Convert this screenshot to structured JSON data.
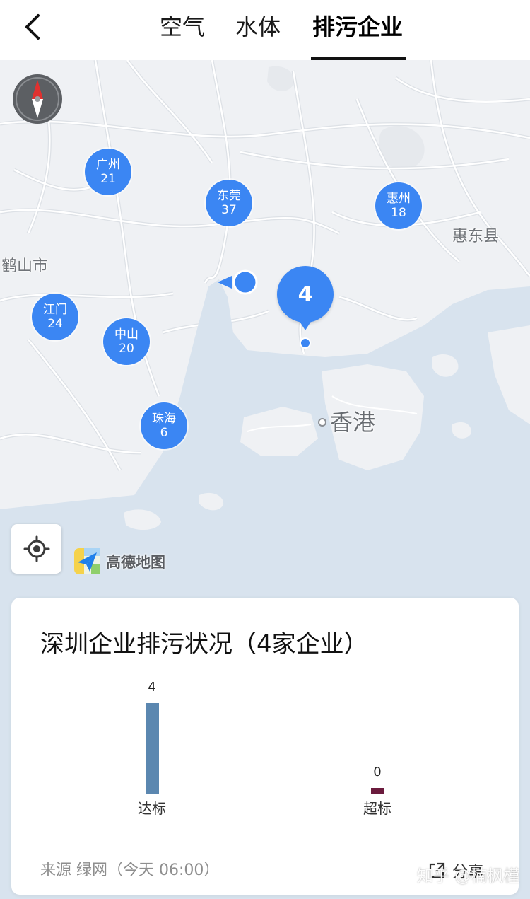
{
  "top_bar": {
    "back_icon": "chevron-left-icon",
    "tabs": [
      {
        "label": "空气",
        "selected": false
      },
      {
        "label": "水体",
        "selected": false
      },
      {
        "label": "排污企业",
        "selected": true
      }
    ]
  },
  "map": {
    "compass_icon": "compass-icon",
    "clusters": [
      {
        "city": "广州",
        "count": 21
      },
      {
        "city": "东莞",
        "count": 37
      },
      {
        "city": "惠州",
        "count": 18
      },
      {
        "city": "江门",
        "count": 24
      },
      {
        "city": "中山",
        "count": 20
      },
      {
        "city": "珠海",
        "count": 6
      }
    ],
    "selected_cluster": {
      "count": 4
    },
    "place_labels": {
      "huidong": "惠东县",
      "heshan": "鹤山市",
      "hongkong": "香港"
    },
    "location_marker_icon": "location-arrow-icon",
    "locate_icon": "crosshair-icon",
    "provider_logo_icon": "amap-logo-icon",
    "provider": "高德地图",
    "colors": {
      "cluster": "#3b86f3",
      "land": "#eff1f4",
      "sea": "#d8e3ee"
    }
  },
  "card": {
    "title": "深圳企业排污状况（4家企业）",
    "source": "来源 绿网（今天 06:00）",
    "share_icon": "share-icon",
    "share_label": "分享"
  },
  "chart_data": {
    "type": "bar",
    "categories": [
      "达标",
      "超标"
    ],
    "values": [
      4,
      0
    ],
    "colors": [
      "#5b87b0",
      "#6b1b3d"
    ]
  },
  "watermark": "知乎 @楠枫槿"
}
